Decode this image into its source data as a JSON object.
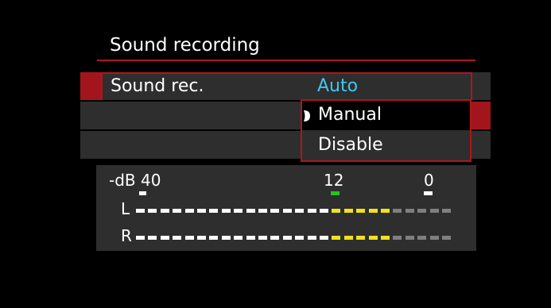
{
  "screen": {
    "title": "Sound recording",
    "menu": {
      "label": "Sound rec.",
      "current_value": "Auto",
      "value_color": "#43c6ee",
      "options": [
        {
          "label": "Manual",
          "highlighted": true
        },
        {
          "label": "Disable",
          "highlighted": false
        }
      ]
    },
    "meter": {
      "scale": {
        "prefix": "-dB",
        "marks": [
          "40",
          "12",
          "0"
        ]
      },
      "channels": [
        {
          "label": "L",
          "level": 0.8
        },
        {
          "label": "R",
          "level": 0.8
        }
      ],
      "segment_count": 26,
      "colors": {
        "white": "#ffffff",
        "yellow": "#f2e21a",
        "gray": "#7f7f7f",
        "green": "#1ec81e"
      }
    },
    "accent_color": "#b0151c"
  }
}
